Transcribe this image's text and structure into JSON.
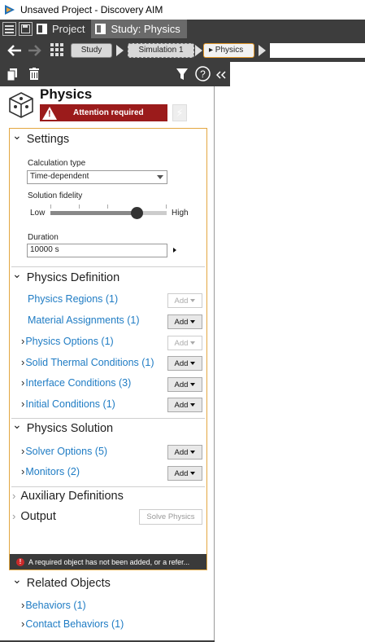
{
  "window": {
    "title": "Unsaved Project - Discovery AIM"
  },
  "tabs": {
    "project": "Project",
    "study": "Study: Physics"
  },
  "breadcrumb": {
    "study": "Study",
    "simulation": "Simulation 1",
    "physics": "▸ Physics"
  },
  "panel": {
    "title": "Physics",
    "attention": "Attention required",
    "settings": {
      "title": "Settings",
      "calc_type_label": "Calculation type",
      "calc_type_value": "Time-dependent",
      "fidelity_label": "Solution fidelity",
      "fidelity_low": "Low",
      "fidelity_high": "High",
      "fidelity_level": 0.74,
      "duration_label": "Duration",
      "duration_value": "10000 s"
    },
    "physics_definition": {
      "title": "Physics Definition",
      "items": [
        {
          "label": "Physics Regions (1)",
          "expandable": false,
          "add": "Add",
          "add_enabled": false
        },
        {
          "label": "Material Assignments (1)",
          "expandable": false,
          "add": "Add",
          "add_enabled": true
        },
        {
          "label": "Physics Options (1)",
          "expandable": true,
          "add": "Add",
          "add_enabled": false
        },
        {
          "label": "Solid Thermal Conditions (1)",
          "expandable": true,
          "add": "Add",
          "add_enabled": true
        },
        {
          "label": "Interface Conditions (3)",
          "expandable": true,
          "add": "Add",
          "add_enabled": true
        },
        {
          "label": "Initial Conditions (1)",
          "expandable": true,
          "add": "Add",
          "add_enabled": true
        }
      ]
    },
    "physics_solution": {
      "title": "Physics Solution",
      "items": [
        {
          "label": "Solver Options (5)",
          "add": "Add"
        },
        {
          "label": "Monitors (2)",
          "add": "Add"
        }
      ]
    },
    "auxiliary": "Auxiliary Definitions",
    "output": "Output",
    "solve_button": "Solve Physics",
    "error_message": "A required object has not been added, or a refer...",
    "related": {
      "title": "Related Objects",
      "items": [
        "Behaviors (1)",
        "Contact Behaviors (1)"
      ]
    }
  },
  "colors": {
    "accent": "#e3a640",
    "attention": "#9b1b1b",
    "link": "#1f7cc4",
    "chrome": "#3d3d3d"
  }
}
